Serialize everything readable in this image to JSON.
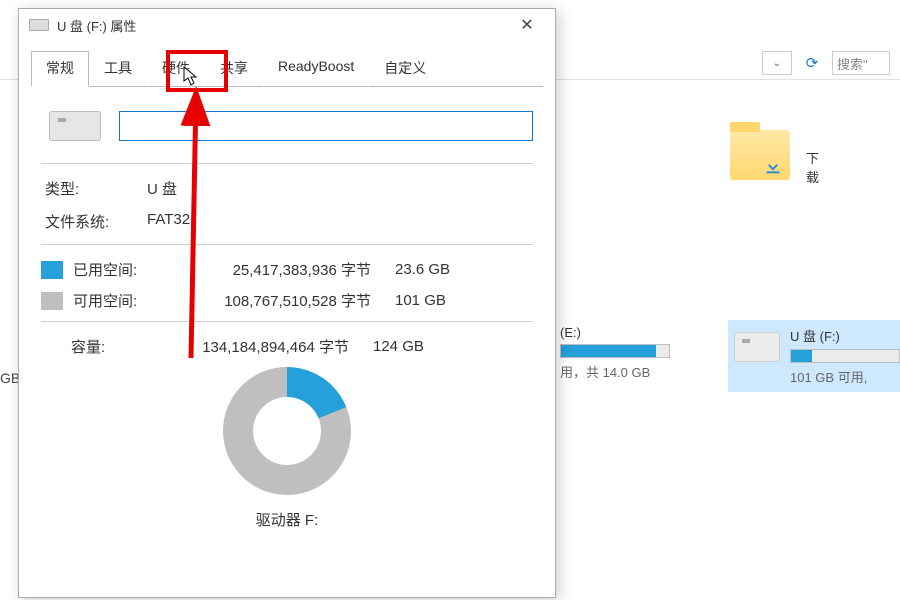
{
  "explorer": {
    "nav_dropdown_glyph": "⌄",
    "refresh_glyph": "⟳",
    "search_placeholder": "搜索\"",
    "downloads_label": "下载",
    "drive_e": {
      "name_suffix": "(E:)",
      "free_suffix": "用，共 14.0 GB",
      "fill_pct": 88
    },
    "drive_f": {
      "name": "U 盘 (F:)",
      "free_text": "101 GB 可用,",
      "fill_pct": 19
    },
    "gb_left_text": "GB"
  },
  "dialog": {
    "title": "U 盘 (F:) 属性",
    "close_glyph": "✕",
    "tabs": [
      "常规",
      "工具",
      "硬件",
      "共享",
      "ReadyBoost",
      "自定义"
    ],
    "active_tab_index": 0,
    "highlight_tab_index": 2,
    "type_label": "类型:",
    "type_value": "U 盘",
    "fs_label": "文件系统:",
    "fs_value": "FAT32",
    "used_label": "已用空间:",
    "used_bytes": "25,417,383,936 字节",
    "used_human": "23.6 GB",
    "free_label": "可用空间:",
    "free_bytes": "108,767,510,528 字节",
    "free_human": "101 GB",
    "capacity_label": "容量:",
    "capacity_bytes": "134,184,894,464 字节",
    "capacity_human": "124 GB",
    "drive_letter_label": "驱动器 F:"
  },
  "chart_data": {
    "type": "pie",
    "title": "驱动器 F:",
    "series": [
      {
        "name": "已用空间",
        "value": 23.6,
        "unit": "GB",
        "color": "#26a0da"
      },
      {
        "name": "可用空间",
        "value": 101,
        "unit": "GB",
        "color": "#bfbfbf"
      }
    ],
    "total": {
      "label": "容量",
      "value": 124,
      "unit": "GB"
    }
  }
}
